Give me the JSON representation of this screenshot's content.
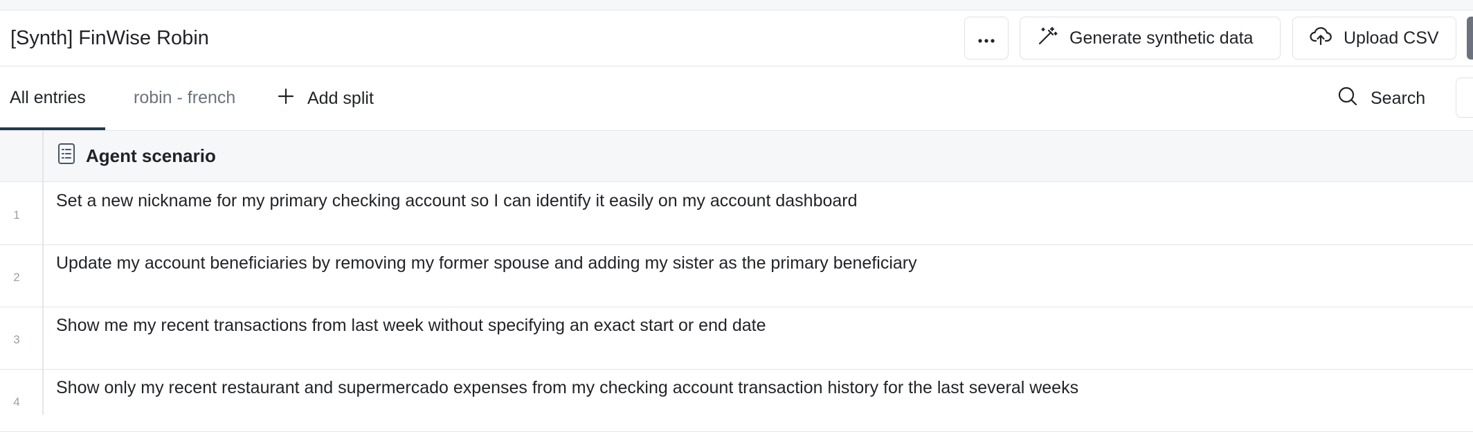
{
  "header": {
    "title": "[Synth] FinWise Robin",
    "more_icon": "ellipsis-icon",
    "generate_label": "Generate synthetic data",
    "generate_icon": "magic-wand-icon",
    "upload_label": "Upload CSV",
    "upload_icon": "cloud-upload-icon"
  },
  "tabs": {
    "items": [
      {
        "label": "All entries",
        "active": true
      },
      {
        "label": "robin - french",
        "active": false
      }
    ],
    "add_split_label": "Add split",
    "search_label": "Search"
  },
  "table": {
    "columns": [
      {
        "label": "Agent scenario",
        "icon": "document-list-icon"
      }
    ],
    "rows": [
      {
        "num": "1",
        "scenario": "Set a new nickname for my primary checking account so I can identify it easily on my account dashboard"
      },
      {
        "num": "2",
        "scenario": "Update my account beneficiaries by removing my former spouse and adding my sister as the primary beneficiary"
      },
      {
        "num": "3",
        "scenario": "Show me my recent transactions from last week without specifying an exact start or end date"
      },
      {
        "num": "4",
        "scenario": "Show only my recent restaurant and supermercado expenses from my checking account transaction history for the last several weeks"
      }
    ]
  },
  "colors": {
    "border": "#e3e5e8",
    "header_bg": "#f6f7f8",
    "active_tab_underline": "#1f3a4a",
    "muted_text": "#6b7280",
    "row_number": "#9aa0a8"
  }
}
